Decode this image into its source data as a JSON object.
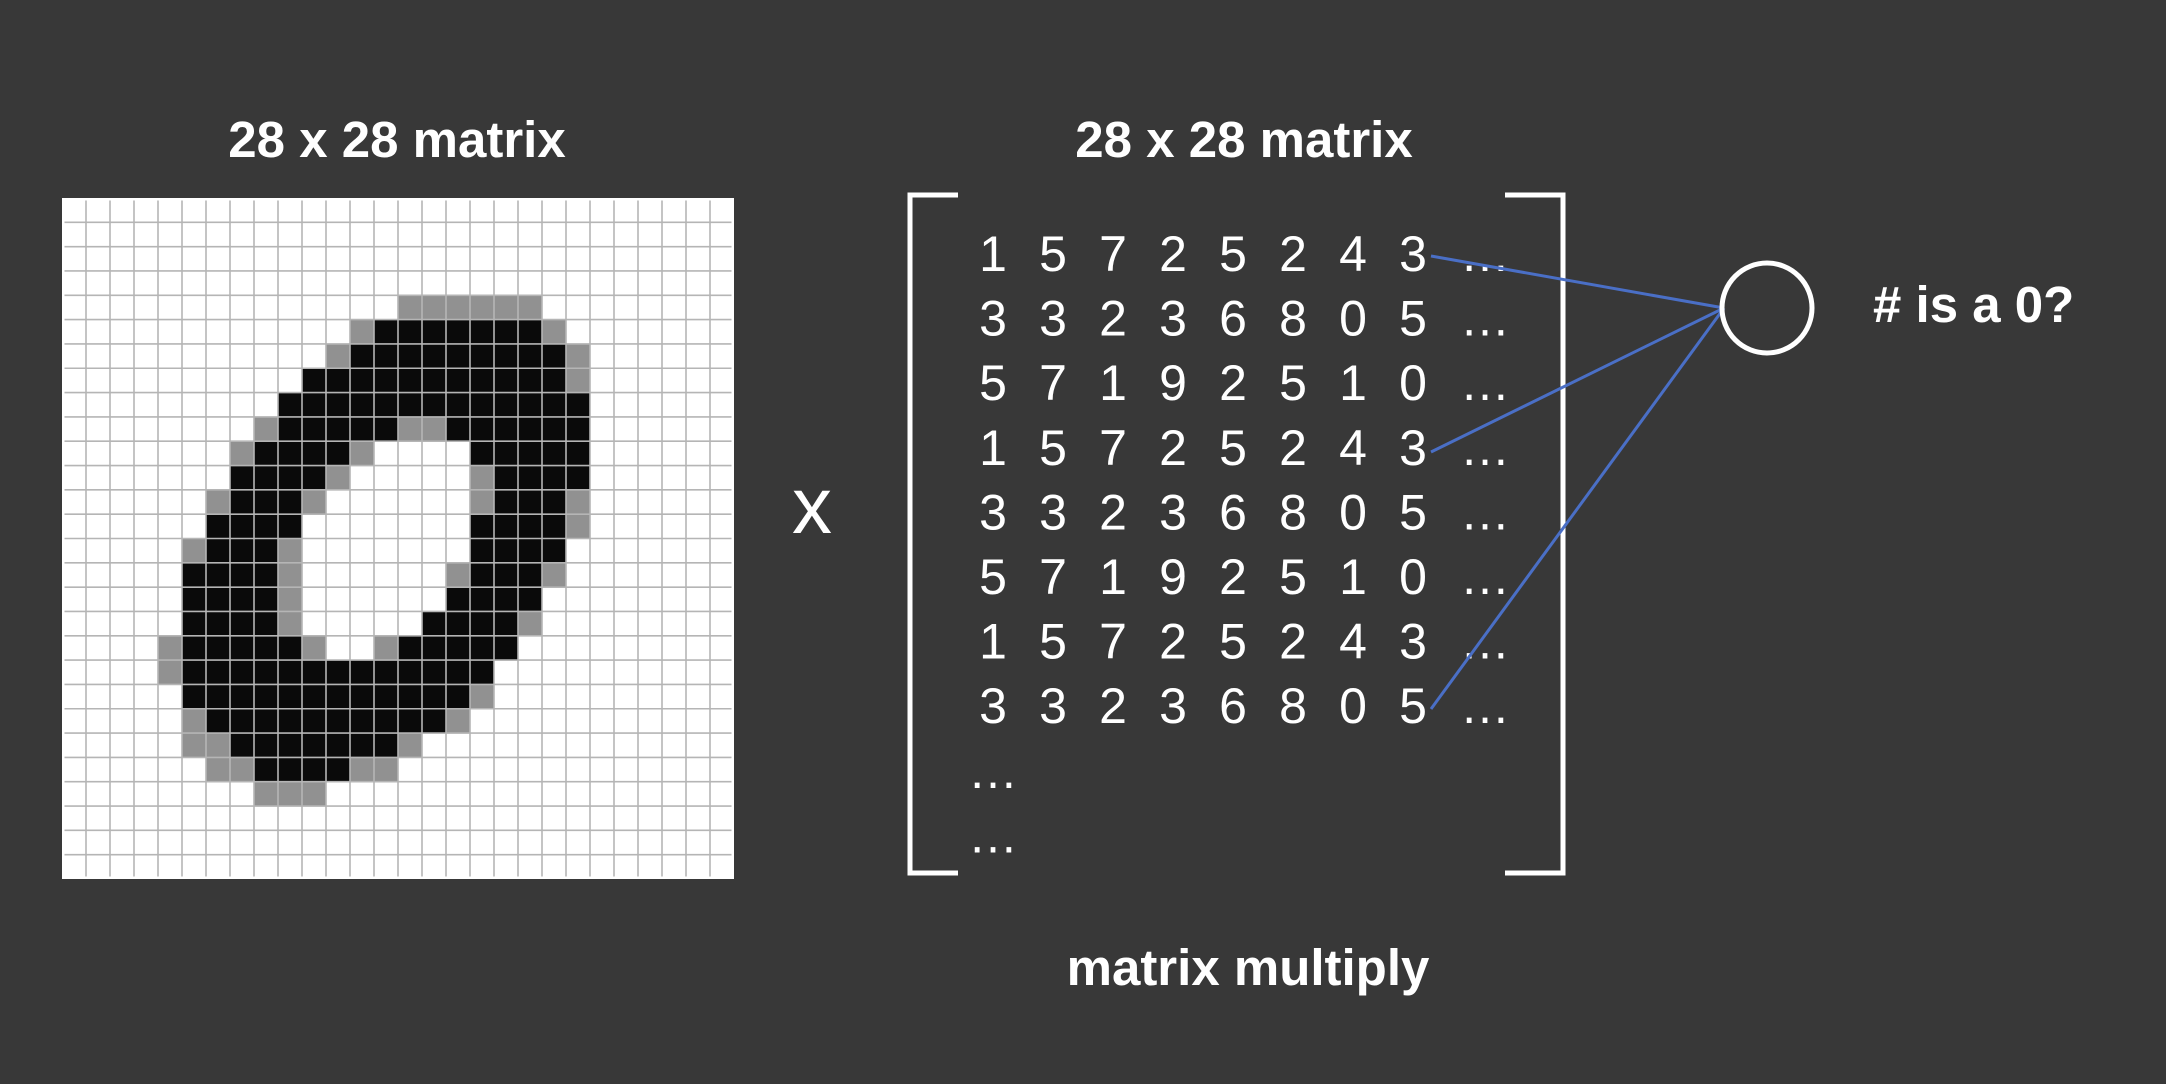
{
  "left_panel": {
    "title": "28 x 28 matrix",
    "image": "handwritten digit zero (pixel grid)",
    "colors": {
      "background": "#ffffff",
      "ink": "#0a0a0a",
      "grid": "#b5b5b5"
    }
  },
  "operator": "x",
  "right_panel": {
    "title": "28 x 28 matrix",
    "rows": [
      [
        "1",
        "5",
        "7",
        "2",
        "5",
        "2",
        "4",
        "3",
        "…"
      ],
      [
        "3",
        "3",
        "2",
        "3",
        "6",
        "8",
        "0",
        "5",
        "…"
      ],
      [
        "5",
        "7",
        "1",
        "9",
        "2",
        "5",
        "1",
        "0",
        "…"
      ],
      [
        "1",
        "5",
        "7",
        "2",
        "5",
        "2",
        "4",
        "3",
        "…"
      ],
      [
        "3",
        "3",
        "2",
        "3",
        "6",
        "8",
        "0",
        "5",
        "…"
      ],
      [
        "5",
        "7",
        "1",
        "9",
        "2",
        "5",
        "1",
        "0",
        "…"
      ],
      [
        "1",
        "5",
        "7",
        "2",
        "5",
        "2",
        "4",
        "3",
        "…"
      ],
      [
        "3",
        "3",
        "2",
        "3",
        "6",
        "8",
        "0",
        "5",
        "…"
      ],
      [
        "…"
      ],
      [
        "…"
      ]
    ],
    "bracket_color": "#ffffff"
  },
  "output_node": {
    "label": "# is a 0?",
    "line_color": "#4a6fc6"
  },
  "caption": "matrix multiply"
}
